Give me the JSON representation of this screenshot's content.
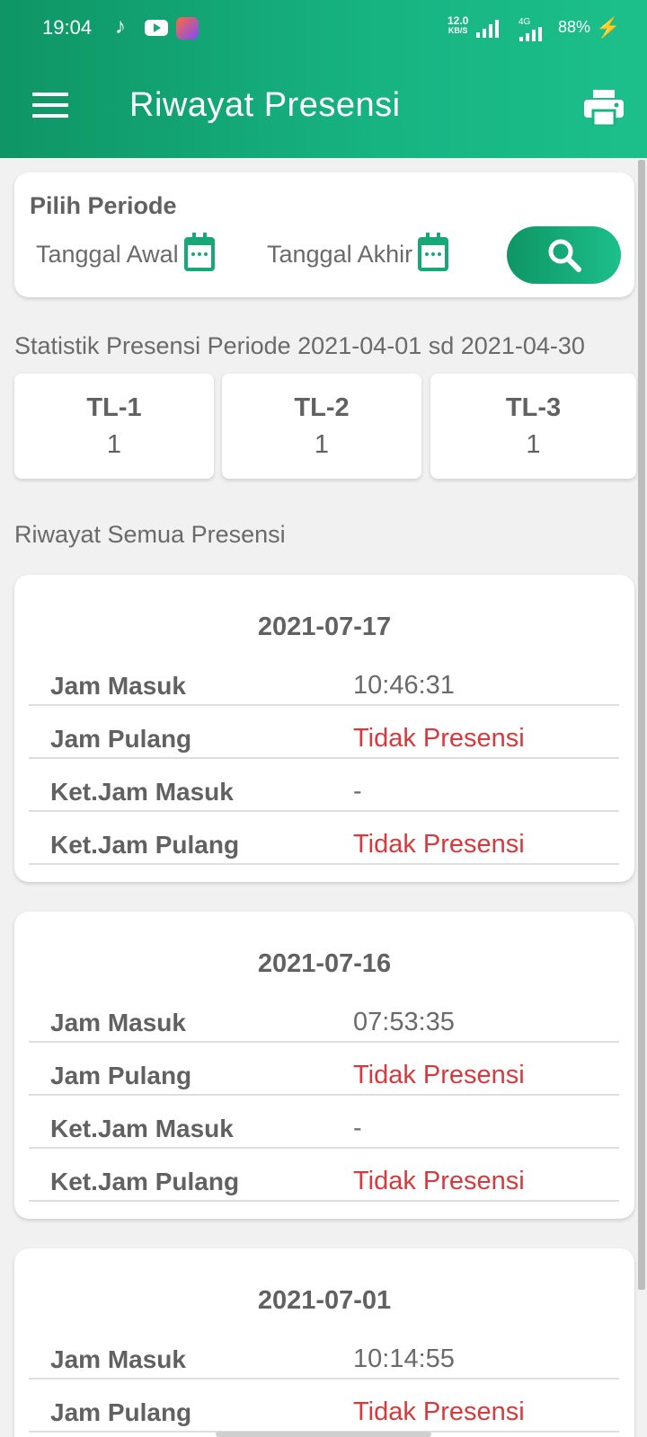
{
  "status_bar": {
    "time": "19:04",
    "net_speed_value": "12.0",
    "net_speed_unit": "KB/S",
    "network": "4G",
    "battery": "88%"
  },
  "app_bar": {
    "title": "Riwayat Presensi",
    "menu_icon": "hamburger-menu-icon",
    "print_icon": "printer-icon"
  },
  "period": {
    "label": "Pilih Periode",
    "start_label": "Tanggal Awal",
    "end_label": "Tanggal Akhir",
    "calendar_icon": "calendar-icon",
    "search_icon": "search-icon"
  },
  "stats": {
    "title": "Statistik Presensi Periode 2021-04-01 sd 2021-04-30",
    "items": [
      {
        "label": "TL-1",
        "value": "1"
      },
      {
        "label": "TL-2",
        "value": "1"
      },
      {
        "label": "TL-3",
        "value": "1"
      }
    ]
  },
  "history": {
    "title": "Riwayat Semua Presensi",
    "records": [
      {
        "date": "2021-07-17",
        "rows": [
          {
            "key": "Jam Masuk",
            "value": "10:46:31",
            "alert": false
          },
          {
            "key": "Jam Pulang",
            "value": "Tidak Presensi",
            "alert": true
          },
          {
            "key": "Ket.Jam Masuk",
            "value": "-",
            "alert": false
          },
          {
            "key": "Ket.Jam Pulang",
            "value": "Tidak Presensi",
            "alert": true
          }
        ]
      },
      {
        "date": "2021-07-16",
        "rows": [
          {
            "key": "Jam Masuk",
            "value": "07:53:35",
            "alert": false
          },
          {
            "key": "Jam Pulang",
            "value": "Tidak Presensi",
            "alert": true
          },
          {
            "key": "Ket.Jam Masuk",
            "value": "-",
            "alert": false
          },
          {
            "key": "Ket.Jam Pulang",
            "value": "Tidak Presensi",
            "alert": true
          }
        ]
      },
      {
        "date": "2021-07-01",
        "rows": [
          {
            "key": "Jam Masuk",
            "value": "10:14:55",
            "alert": false
          },
          {
            "key": "Jam Pulang",
            "value": "Tidak Presensi",
            "alert": true
          }
        ]
      }
    ]
  },
  "colors": {
    "primary": "#17a877",
    "alert": "#d8393c"
  }
}
